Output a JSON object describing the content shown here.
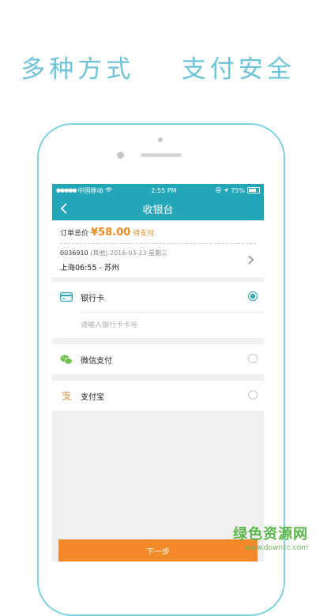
{
  "headline": "多种方式    支付安全",
  "status_bar": {
    "carrier": "中国移动",
    "time": "2:55 PM",
    "battery": "75%"
  },
  "nav": {
    "title": "收银台",
    "back_icon": "chevron-left-icon"
  },
  "order": {
    "total_label": "订单总价",
    "amount": "¥58.00",
    "status": "待支付",
    "train_no": "0036910",
    "meta": "(其他) 2016-03-23 星期三",
    "route": "上海06:55 - 苏州"
  },
  "payment_options": [
    {
      "label": "银行卡",
      "icon": "bank-card-icon",
      "selected": true
    },
    {
      "label": "微信支付",
      "icon": "wechat-icon",
      "selected": false
    },
    {
      "label": "支付宝",
      "icon": "alipay-icon",
      "selected": false
    }
  ],
  "card_input": {
    "placeholder": "请输入银行卡卡号",
    "value": ""
  },
  "next_button": "下一步",
  "watermark": {
    "main": "绿色资源网",
    "sub": "www.downcc.com"
  },
  "colors": {
    "accent": "#22a6b8",
    "price": "#f08a1c",
    "button": "#f5892a"
  }
}
